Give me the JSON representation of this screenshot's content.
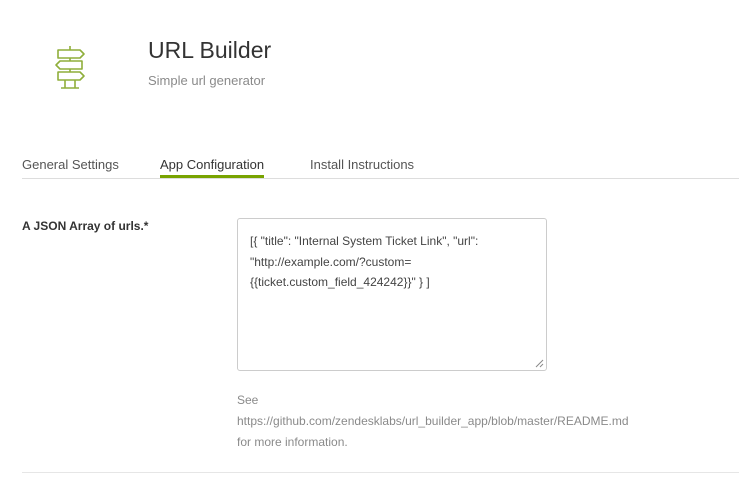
{
  "app": {
    "title": "URL Builder",
    "subtitle": "Simple url generator",
    "icon": "signpost-icon",
    "accent_color": "#78a300"
  },
  "tabs": [
    {
      "label": "General Settings",
      "active": false
    },
    {
      "label": "App Configuration",
      "active": true
    },
    {
      "label": "Install Instructions",
      "active": false
    }
  ],
  "field": {
    "label": "A JSON Array of urls.*",
    "value": "[{ \"title\": \"Internal System Ticket Link\", \"url\": \"http://example.com/?custom={{ticket.custom_field_424242}}\" } ]",
    "hint": [
      "See",
      "https://github.com/zendesklabs/url_builder_app/blob/master/README.md",
      "for more information."
    ]
  }
}
